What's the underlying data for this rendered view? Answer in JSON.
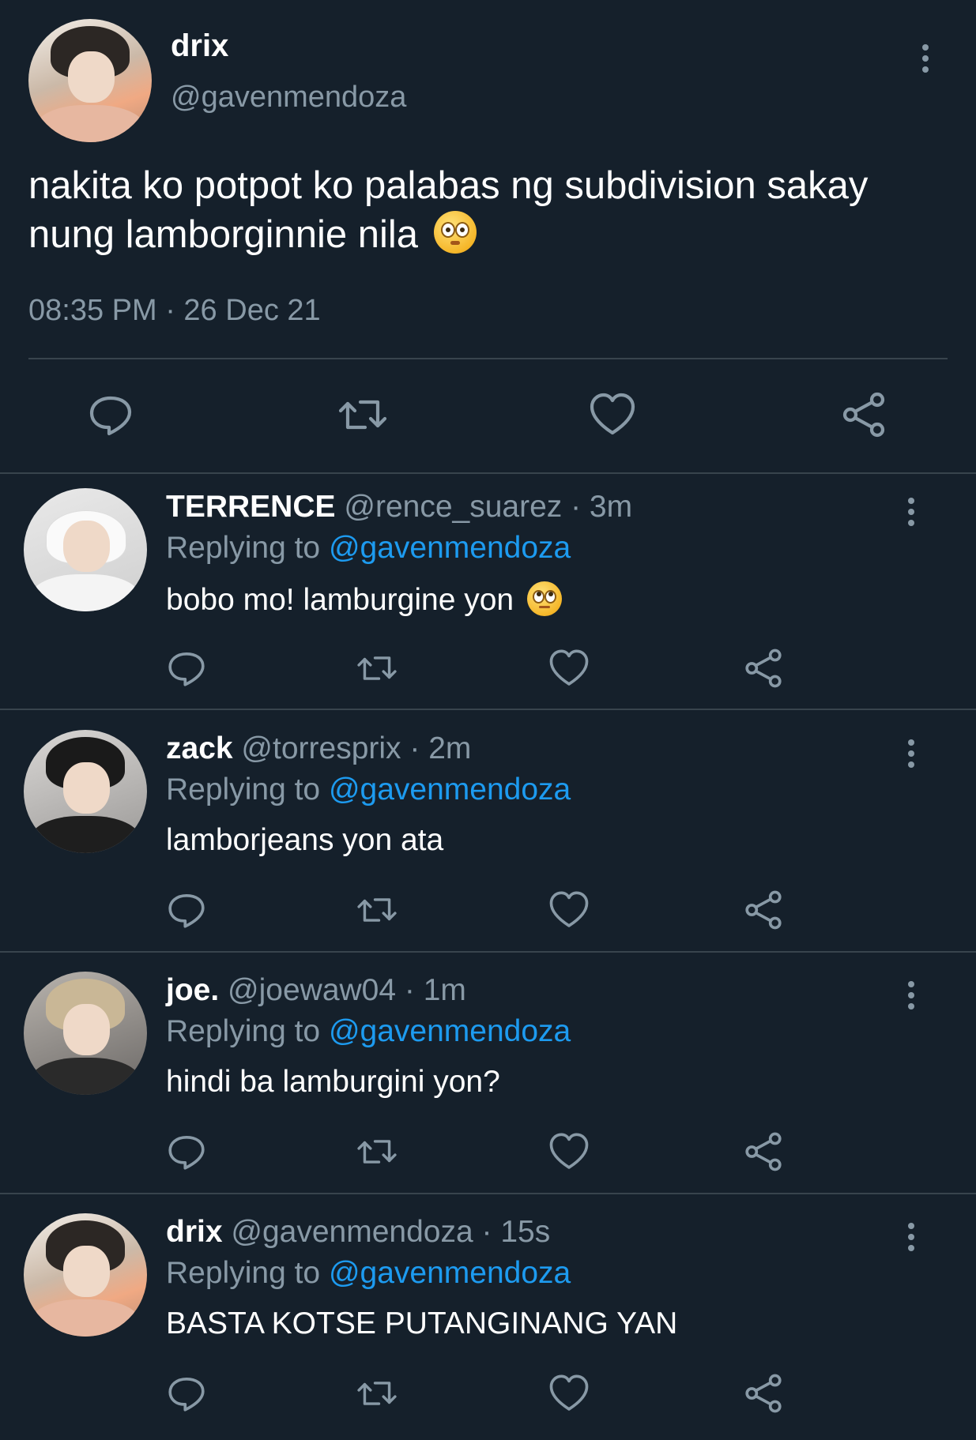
{
  "main_tweet": {
    "author_name": "drix",
    "handle": "@gavenmendoza",
    "text": "nakita ko potpot ko palabas ng subdivision sakay nung lamborginnie nila",
    "emoji": "flushed-face-emoji",
    "timestamp": "08:35 PM · 26 Dec 21"
  },
  "replies": [
    {
      "name": "TERRENCE",
      "meta": "@rence_suarez · 3m",
      "replying_prefix": "Replying to ",
      "replying_handle": "@gavenmendoza",
      "text": "bobo mo! lamburgine yon",
      "emoji": "face-with-rolling-eyes-emoji"
    },
    {
      "name": "zack",
      "meta": "@torresprix · 2m",
      "replying_prefix": "Replying to ",
      "replying_handle": "@gavenmendoza",
      "text": "lamborjeans yon ata"
    },
    {
      "name": "joe.",
      "meta": "@joewaw04 · 1m",
      "replying_prefix": "Replying to ",
      "replying_handle": "@gavenmendoza",
      "text": "hindi ba lamburgini yon?"
    },
    {
      "name": "drix",
      "meta": "@gavenmendoza · 15s",
      "replying_prefix": "Replying to ",
      "replying_handle": "@gavenmendoza",
      "text": "BASTA KOTSE PUTANGINANG YAN"
    }
  ],
  "colors": {
    "background": "#15202b",
    "secondary_text": "#8899a6",
    "mention": "#1d9bf0",
    "divider": "#38444d"
  },
  "icons": [
    "reply-icon",
    "retweet-icon",
    "like-icon",
    "share-icon",
    "more-options-icon"
  ]
}
